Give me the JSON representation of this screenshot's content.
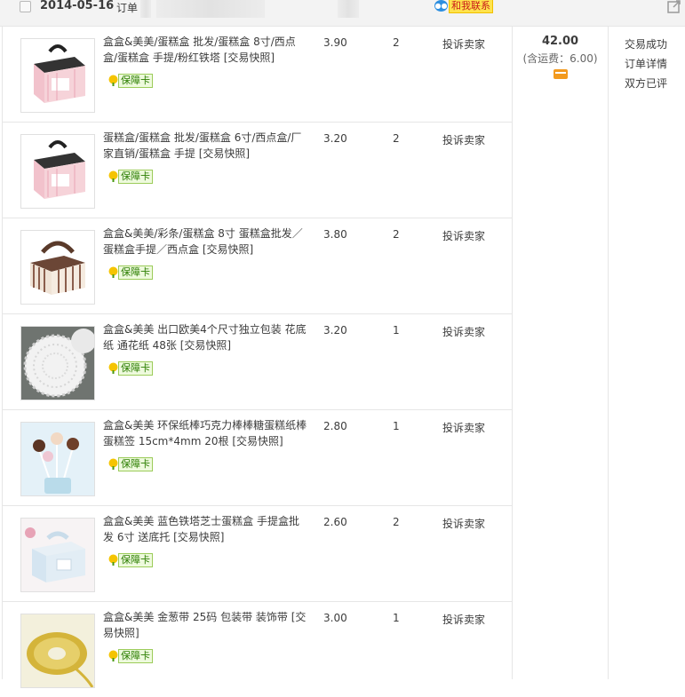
{
  "order": {
    "date": "2014-05-16",
    "order_label": "订单",
    "contact_label": "和我联系",
    "total": "42.00",
    "shipping_note": "(含运费：6.00)",
    "status": [
      "交易成功",
      "订单详情",
      "双方已评"
    ]
  },
  "badge_label": "保障卡",
  "items": [
    {
      "title": "盒盒&美美/蛋糕盒 批发/蛋糕盒 8寸/西点盒/蛋糕盒 手提/粉红铁塔",
      "snapshot": "[交易快照]",
      "price": "3.90",
      "qty": "2",
      "action": "投诉卖家",
      "thumb": "pink-box"
    },
    {
      "title": "蛋糕盒/蛋糕盒 批发/蛋糕盒 6寸/西点盒/厂家直销/蛋糕盒 手提",
      "snapshot": "[交易快照]",
      "price": "3.20",
      "qty": "2",
      "action": "投诉卖家",
      "thumb": "pink-box"
    },
    {
      "title": "盒盒&美美/彩条/蛋糕盒 8寸 蛋糕盒批发／蛋糕盒手提／西点盒",
      "snapshot": "[交易快照]",
      "price": "3.80",
      "qty": "2",
      "action": "投诉卖家",
      "thumb": "stripe-box"
    },
    {
      "title": "盒盒&美美 出口欧美4个尺寸独立包装 花底纸 通花纸 48张",
      "snapshot": "[交易快照]",
      "price": "3.20",
      "qty": "1",
      "action": "投诉卖家",
      "thumb": "doily"
    },
    {
      "title": "盒盒&美美 环保纸棒巧克力棒棒糖蛋糕纸棒 蛋糕签 15cm*4mm 20根",
      "snapshot": "[交易快照]",
      "price": "2.80",
      "qty": "1",
      "action": "投诉卖家",
      "thumb": "lollipop"
    },
    {
      "title": "盒盒&美美 蓝色铁塔芝士蛋糕盒 手提盒批发 6寸 送底托",
      "snapshot": "[交易快照]",
      "price": "2.60",
      "qty": "2",
      "action": "投诉卖家",
      "thumb": "blue-box"
    },
    {
      "title": "盒盒&美美 金葱带 25码 包装带 装饰带",
      "snapshot": "[交易快照]",
      "price": "3.00",
      "qty": "1",
      "action": "投诉卖家",
      "thumb": "ribbon"
    }
  ]
}
